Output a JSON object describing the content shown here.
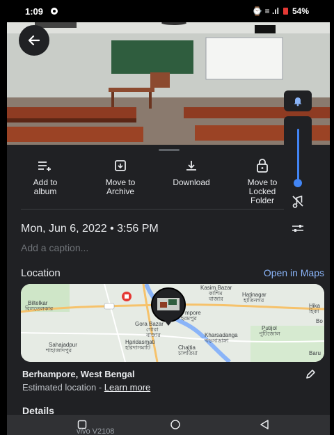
{
  "status_bar": {
    "time": "1:09",
    "indicators": "⌚ ≡ .ıl",
    "battery": "54%"
  },
  "photo": {
    "label": "photo-preview"
  },
  "actions": [
    {
      "label": "Add to\nalbum",
      "icon": "playlist-add-icon"
    },
    {
      "label": "Move to\nArchive",
      "icon": "archive-icon"
    },
    {
      "label": "Download",
      "icon": "download-icon"
    },
    {
      "label": "Move to\nLocked\nFolder",
      "icon": "lock-icon"
    }
  ],
  "datetime": "Mon, Jun 6, 2022  •  3:56 PM",
  "caption_placeholder": "Add a caption...",
  "location": {
    "heading": "Location",
    "open_maps": "Open in Maps",
    "place": "Berhampore, West Bengal",
    "estimated": "Estimated location - ",
    "learn_more": "Learn more"
  },
  "map_labels": [
    {
      "text": "Biltelkar"
    },
    {
      "text": "বিলতেলকার"
    },
    {
      "text": "Kasim Bazar"
    },
    {
      "text": "কাশিম"
    },
    {
      "text": "বাজার"
    },
    {
      "text": "Hatinagar"
    },
    {
      "text": "হাতিনগর"
    },
    {
      "text": "Hika"
    },
    {
      "text": "হিকা"
    },
    {
      "text": "Gora Bazar"
    },
    {
      "text": "গোরা"
    },
    {
      "text": "বাজার"
    },
    {
      "text": "Haridasmati"
    },
    {
      "text": "হরিদাসমাটি"
    },
    {
      "text": "Chaltia"
    },
    {
      "text": "চালতিয়া"
    },
    {
      "text": "Kharsadanga"
    },
    {
      "text": "খড়সাডাঙ্গা"
    },
    {
      "text": "Putijol"
    },
    {
      "text": "পুটিজোল"
    },
    {
      "text": "Sahajadpur"
    },
    {
      "text": "শাহাজাদপুর"
    },
    {
      "text": "Baru"
    },
    {
      "text": "Bo"
    },
    {
      "text": "mpore"
    },
    {
      "text": "হরমপুর"
    }
  ],
  "details_heading": "Details",
  "device_label": "vivo V2108",
  "colors": {
    "sheet_bg": "#202124",
    "link_blue": "#8ab4f8",
    "slider_blue": "#4285f4",
    "map_bg": "#e6ebe4"
  }
}
